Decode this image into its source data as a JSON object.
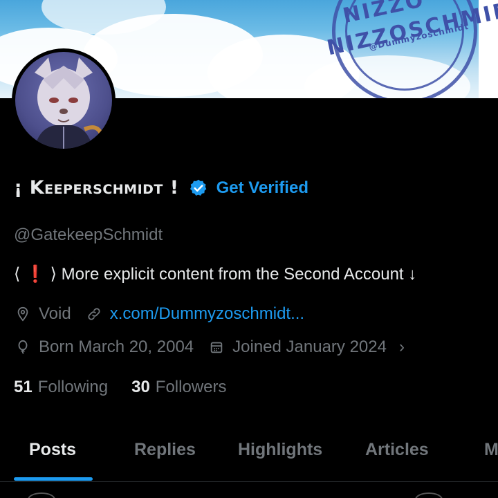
{
  "banner": {
    "stamp_line1": "NIZZO",
    "stamp_line2": "NIZZOSCHMIDT",
    "stamp_handle": "@Dummyzoschmidt"
  },
  "profile": {
    "display_name": "¡ Keeperschmidt !",
    "get_verified_label": "Get Verified",
    "handle": "@GatekeepSchmidt",
    "bio_open": "⟨",
    "bio_excl": "❗",
    "bio_close": "⟩",
    "bio_text": "More explicit content from the Second Account ↓",
    "location": "Void",
    "website": "x.com/Dummyzoschmidt...",
    "born": "Born March 20, 2004",
    "joined": "Joined January 2024",
    "following_count": "51",
    "following_label": "Following",
    "followers_count": "30",
    "followers_label": "Followers"
  },
  "tabs": [
    {
      "label": "Posts",
      "active": true
    },
    {
      "label": "Replies",
      "active": false
    },
    {
      "label": "Highlights",
      "active": false
    },
    {
      "label": "Articles",
      "active": false
    },
    {
      "label": "M",
      "active": false
    }
  ],
  "colors": {
    "accent": "#1d9bf0",
    "background": "#000000",
    "text_primary": "#e7e9ea",
    "text_secondary": "#71767b"
  },
  "icons": {
    "verified": "verified-badge-icon",
    "location": "location-pin-icon",
    "link": "link-icon",
    "birthday": "balloon-icon",
    "calendar": "calendar-icon",
    "chevron": "chevron-right-icon"
  }
}
